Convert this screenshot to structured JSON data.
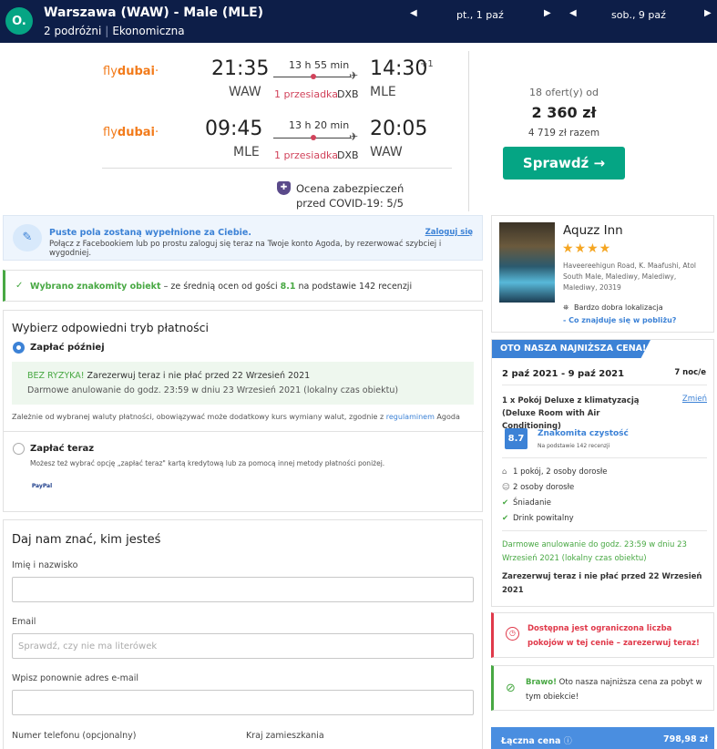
{
  "topbar": {
    "logo_glyph": "O.",
    "route": "Warszawa (WAW) - Male (MLE)",
    "travellers": "2 podróżni",
    "cabin": "Ekonomiczna",
    "separator": "|",
    "depart_date": "pt., 1 paź",
    "return_date": "sob., 9 paź",
    "arrow_left": "◀",
    "arrow_right": "▶"
  },
  "flights": {
    "outbound": {
      "airline_a": "fly",
      "airline_b": "dubai",
      "airline_tail": "·",
      "dep_time": "21:35",
      "dep_iata": "WAW",
      "duration": "13 h 55 min",
      "stops": "1 przesiadka",
      "via": "DXB",
      "arr_time": "14:30",
      "arr_days": "+1",
      "arr_iata": "MLE"
    },
    "inbound": {
      "airline_a": "fly",
      "airline_b": "dubai",
      "airline_tail": "·",
      "dep_time": "09:45",
      "dep_iata": "MLE",
      "duration": "13 h 20 min",
      "stops": "1 przesiadka",
      "via": "DXB",
      "arr_time": "20:05",
      "arr_iata": "WAW"
    },
    "plane_glyph": "✈",
    "covid_line1": "Ocena zabezpieczeń",
    "covid_line2": "przed COVID-19: 5/5"
  },
  "pricing": {
    "offers": "18 ofert(y) od",
    "price": "2 360 zł",
    "total": "4 719 zł razem",
    "check_button": "Sprawdź →"
  },
  "login_banner": {
    "title": "Puste pola zostaną wypełnione za Ciebie.",
    "subtitle": "Połącz z Facebookiem lub po prostu zaloguj się teraz na Twoje konto Agoda, by rezerwować szybciej i wygodniej.",
    "link": "Zaloguj się"
  },
  "choice_banner": {
    "check": "✓",
    "highlight": "Wybrano znakomity obiekt",
    "mid": " – ze średnią ocen od gości ",
    "score": "8.1",
    "tail": " na podstawie 142 recenzji"
  },
  "payment": {
    "title": "Wybierz odpowiedni tryb płatności",
    "pay_later": "Zapłać później",
    "risk_label": "BEZ RYZYKA!",
    "risk_text": " Zarezerwuj teraz i nie płać przed 22 Wrzesień 2021",
    "free_cancel": "Darmowe anulowanie do godz. 23:59 w dniu 23 Wrzesień 2021 (lokalny czas obiektu)",
    "currency_note": "Zależnie od wybranej waluty płatności, obowiązywać może dodatkowy kurs wymiany walut, zgodnie z ",
    "currency_link": "regulaminem",
    "currency_tail": " Agoda",
    "pay_now": "Zapłać teraz",
    "pay_now_sub": "Możesz też wybrać opcję „zapłać teraz\" kartą kredytową lub za pomocą innej metody płatności poniżej.",
    "paypal": "PayPal"
  },
  "identity": {
    "title": "Daj nam znać, kim jesteś",
    "name_label": "Imię i nazwisko",
    "name_value": "",
    "email_label": "Email",
    "email_placeholder": "Sprawdź, czy nie ma literówek",
    "email2_label": "Wpisz ponownie adres e-mail",
    "email2_value": "",
    "phone_label": "Numer telefonu (opcjonalny)",
    "country_label": "Kraj zamieszkania"
  },
  "hotel": {
    "name": "Aquzz Inn",
    "stars": "★★★★",
    "address": "Haveereehigun Road, K. Maafushi, Atol South Male, Malediwy, Malediwy, Malediwy, 20319",
    "location_icon": "⛯",
    "location": "Bardzo dobra lokalizacja",
    "nearby": "- Co znajduje się w pobliżu?"
  },
  "booking": {
    "ribbon": "OTO NASZA NAJNIŻSZA CENA!",
    "dates": "2 paź 2021 - 9 paź 2021",
    "nights": "7 noc/e",
    "room": "1 x Pokój Deluxe z klimatyzacją (Deluxe Room with Air Conditioning)",
    "change": "Zmień",
    "score": "8.7",
    "score_title": "Znakomita czystość",
    "score_sub": "Na podstawie 142 recenzji",
    "amenities": [
      {
        "icon": "⌂",
        "text": "1 pokój, 2 osoby dorosłe"
      },
      {
        "icon": "☺",
        "text": "2 osoby dorosłe"
      },
      {
        "icon": "✔",
        "text": "Śniadanie"
      },
      {
        "icon": "✔",
        "text": "Drink powitalny"
      }
    ],
    "free_cancel": "Darmowe anulowanie do godz. 23:59 w dniu 23 Wrzesień 2021 (lokalny czas obiektu)",
    "book_now": "Zarezerwuj teraz i nie płać przed 22 Wrzesień 2021"
  },
  "alerts": {
    "red_icon": "◷",
    "red_text": "Dostępna jest ograniczona liczba pokojów w tej cenie – zarezerwuj teraz!",
    "green_icon": "⊘",
    "green_bold": "Brawo!",
    "green_text": " Oto nasza najniższa cena za pobyt w tym obiekcie!"
  },
  "total": {
    "label": "Łączna cena",
    "info": "ⓘ",
    "value": "798,98 zł"
  }
}
